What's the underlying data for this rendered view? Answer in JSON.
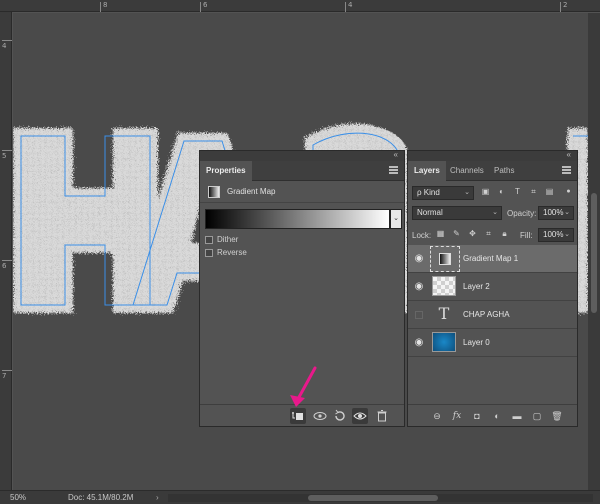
{
  "rulers": {
    "top_labels": [
      "8",
      "6",
      "4",
      "2"
    ],
    "left_labels": [
      "4",
      "5",
      "6",
      "7"
    ]
  },
  "status": {
    "zoom": "50%",
    "doc": "Doc: 45.1M/80.2M",
    "arrow": "›"
  },
  "properties": {
    "tab": "Properties",
    "title": "Gradient Map",
    "dropdown_caret": "⌄",
    "options": [
      {
        "label": "Dither",
        "checked": false
      },
      {
        "label": "Reverse",
        "checked": false
      }
    ],
    "footer_buttons": [
      "clip-to-layer",
      "view-previous",
      "reset",
      "toggle-visibility",
      "delete"
    ]
  },
  "layers_panel": {
    "tabs": [
      "Layers",
      "Channels",
      "Paths"
    ],
    "filter_kind": "ρ Kind",
    "blend_mode": "Normal",
    "opacity_label": "Opacity:",
    "opacity_value": "100%",
    "lock_label": "Lock:",
    "fill_label": "Fill:",
    "fill_value": "100%",
    "layers": [
      {
        "name": "Gradient Map 1",
        "visible": true,
        "selected": true,
        "kind": "adjustment"
      },
      {
        "name": "Layer 2",
        "visible": true,
        "selected": false,
        "kind": "pixel"
      },
      {
        "name": "CHAP AGHA",
        "visible": false,
        "selected": false,
        "kind": "text"
      },
      {
        "name": "Layer 0",
        "visible": true,
        "selected": false,
        "kind": "fill"
      }
    ],
    "text_glyph": "T"
  },
  "colors": {
    "panel_bg": "#535353",
    "canvas_bg": "#4a4a4a",
    "path_outline": "#3a8fe8",
    "arrow": "#e8198b",
    "layer0_blue": "#1670a8"
  }
}
